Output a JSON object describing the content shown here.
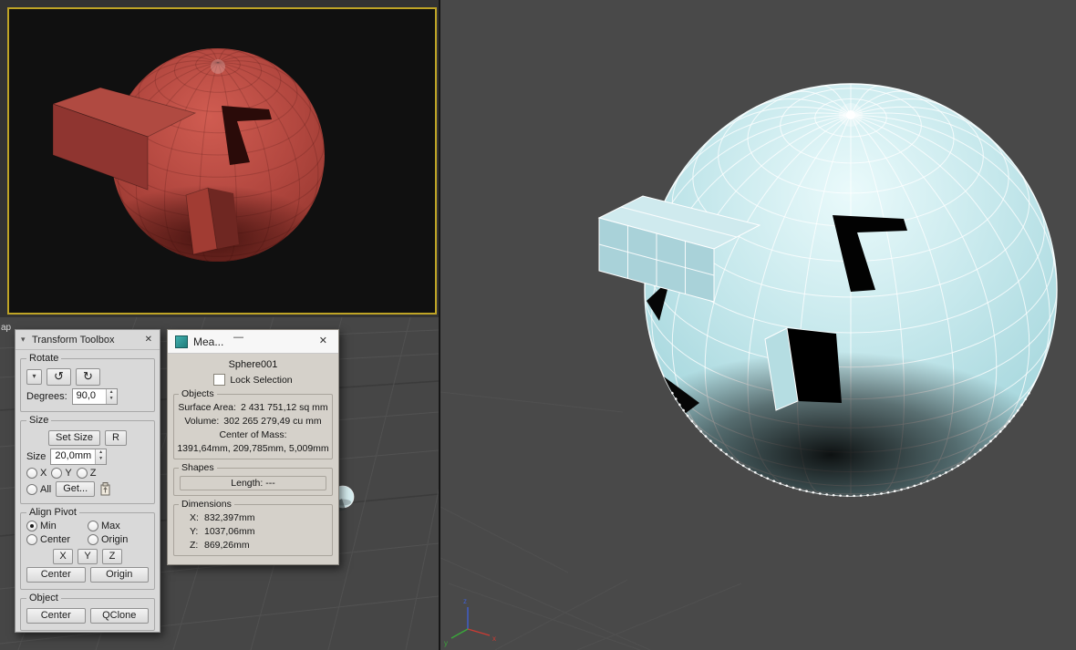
{
  "window": {
    "side_label": "ap"
  },
  "viewports": {
    "axis_labels": {
      "x": "x",
      "y": "y",
      "z": "z"
    }
  },
  "colors": {
    "viewport_border": "#bfa426",
    "red_sphere": "#b2473f",
    "cyan_sphere": "#bfe3e8",
    "axis_x": "#cc3b33",
    "axis_y": "#3aa83a",
    "axis_z": "#4060d0"
  },
  "icons": {
    "close": "✕",
    "minimize": "—",
    "menu": "▾",
    "dropdown": "▾",
    "rotate_ccw": "↺",
    "rotate_cw": "↻",
    "spin_up": "▲",
    "spin_down": "▼"
  },
  "transform_toolbox": {
    "title": "Transform Toolbox",
    "rotate": {
      "label": "Rotate",
      "degrees_label": "Degrees:",
      "degrees_value": "90,0"
    },
    "size": {
      "label": "Size",
      "set_size": "Set Size",
      "r_button": "R",
      "size_label": "Size",
      "size_value": "20,0mm",
      "axis_x": "X",
      "axis_y": "Y",
      "axis_z": "Z",
      "all": "All",
      "get": "Get..."
    },
    "align_pivot": {
      "label": "Align Pivot",
      "min": "Min",
      "max": "Max",
      "center": "Center",
      "origin": "Origin",
      "axis_x": "X",
      "axis_y": "Y",
      "axis_z": "Z",
      "center_button": "Center",
      "origin_button": "Origin"
    },
    "object": {
      "label": "Object",
      "center": "Center",
      "qclone": "QClone"
    }
  },
  "measure_dialog": {
    "title": "Mea...",
    "object_name": "Sphere001",
    "lock_selection": "Lock Selection",
    "objects": {
      "label": "Objects",
      "surface_area_label": "Surface Area:",
      "surface_area_value": "2 431 751,12 sq mm",
      "volume_label": "Volume:",
      "volume_value": "302 265 279,49 cu mm",
      "center_of_mass_label": "Center of Mass:",
      "center_of_mass_value": "1391,64mm,  209,785mm,  5,009mm"
    },
    "shapes": {
      "label": "Shapes",
      "length": "Length: ---"
    },
    "dimensions": {
      "label": "Dimensions",
      "x_label": "X:",
      "x_value": "832,397mm",
      "y_label": "Y:",
      "y_value": "1037,06mm",
      "z_label": "Z:",
      "z_value": "869,26mm"
    }
  }
}
